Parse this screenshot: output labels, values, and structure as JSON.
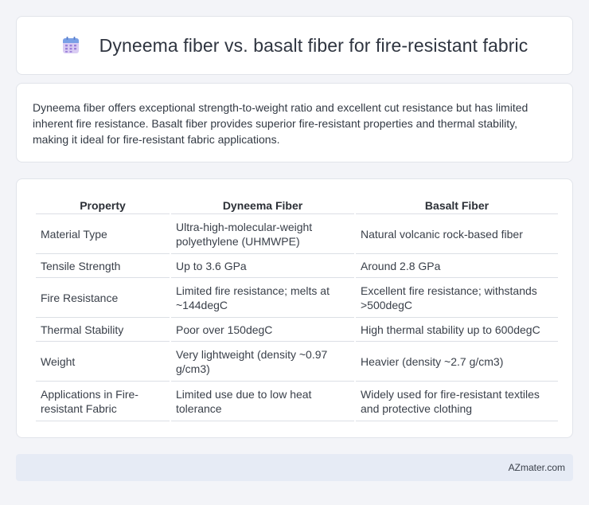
{
  "header": {
    "title": "Dyneema fiber vs. basalt fiber for fire-resistant fabric",
    "icon": "calendar-grid-icon",
    "icon_colors": {
      "top": "#7aa0e6",
      "body": "#c9b5ec",
      "dots": "#9a7fd9"
    }
  },
  "summary": {
    "text": "Dyneema fiber offers exceptional strength-to-weight ratio and excellent cut resistance but has limited inherent fire resistance. Basalt fiber provides superior fire-resistant properties and thermal stability, making it ideal for fire-resistant fabric applications."
  },
  "table": {
    "headers": [
      "Property",
      "Dyneema Fiber",
      "Basalt Fiber"
    ],
    "rows": [
      [
        "Material Type",
        "Ultra-high-molecular-weight polyethylene (UHMWPE)",
        "Natural volcanic rock-based fiber"
      ],
      [
        "Tensile Strength",
        "Up to 3.6 GPa",
        "Around 2.8 GPa"
      ],
      [
        "Fire Resistance",
        "Limited fire resistance; melts at ~144degC",
        "Excellent fire resistance; withstands >500degC"
      ],
      [
        "Thermal Stability",
        "Poor over 150degC",
        "High thermal stability up to 600degC"
      ],
      [
        "Weight",
        "Very lightweight (density ~0.97 g/cm3)",
        "Heavier (density ~2.7 g/cm3)"
      ],
      [
        "Applications in Fire-resistant Fabric",
        "Limited use due to low heat tolerance",
        "Widely used for fire-resistant textiles and protective clothing"
      ]
    ]
  },
  "footer": {
    "text": "AZmater.com"
  }
}
